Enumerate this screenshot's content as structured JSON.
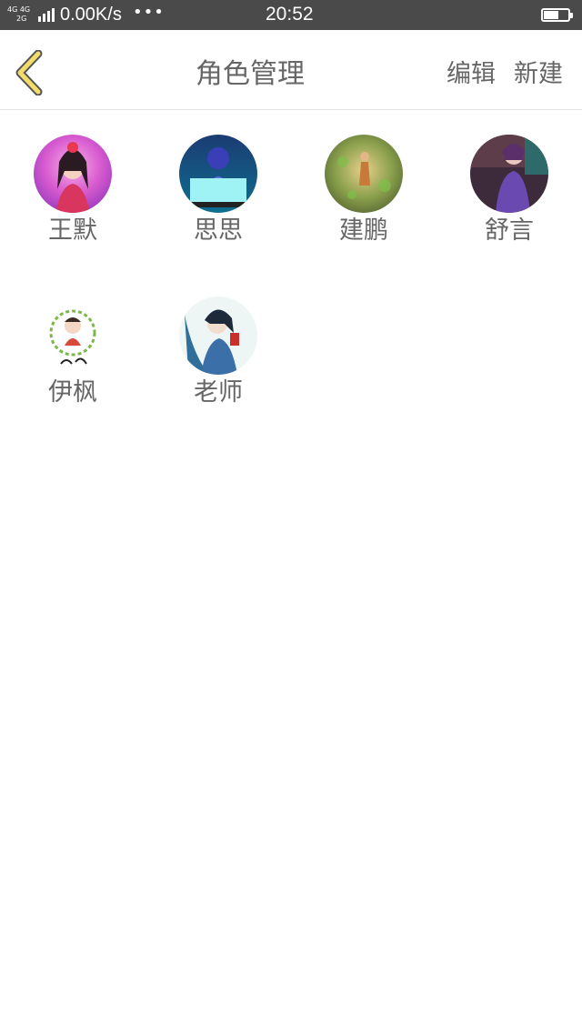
{
  "status_bar": {
    "network_top": "4G 4G",
    "network_bottom": "2G",
    "speed": "0.00K/s",
    "dots": "•••",
    "time": "20:52",
    "battery_level": 0.6
  },
  "header": {
    "back_icon": "chevron-left-icon",
    "title": "角色管理",
    "edit_label": "编辑",
    "new_label": "新建"
  },
  "roles": [
    {
      "name": "王默"
    },
    {
      "name": "思思"
    },
    {
      "name": "建鹏"
    },
    {
      "name": "舒言"
    },
    {
      "name": "伊枫"
    },
    {
      "name": "老师"
    }
  ]
}
